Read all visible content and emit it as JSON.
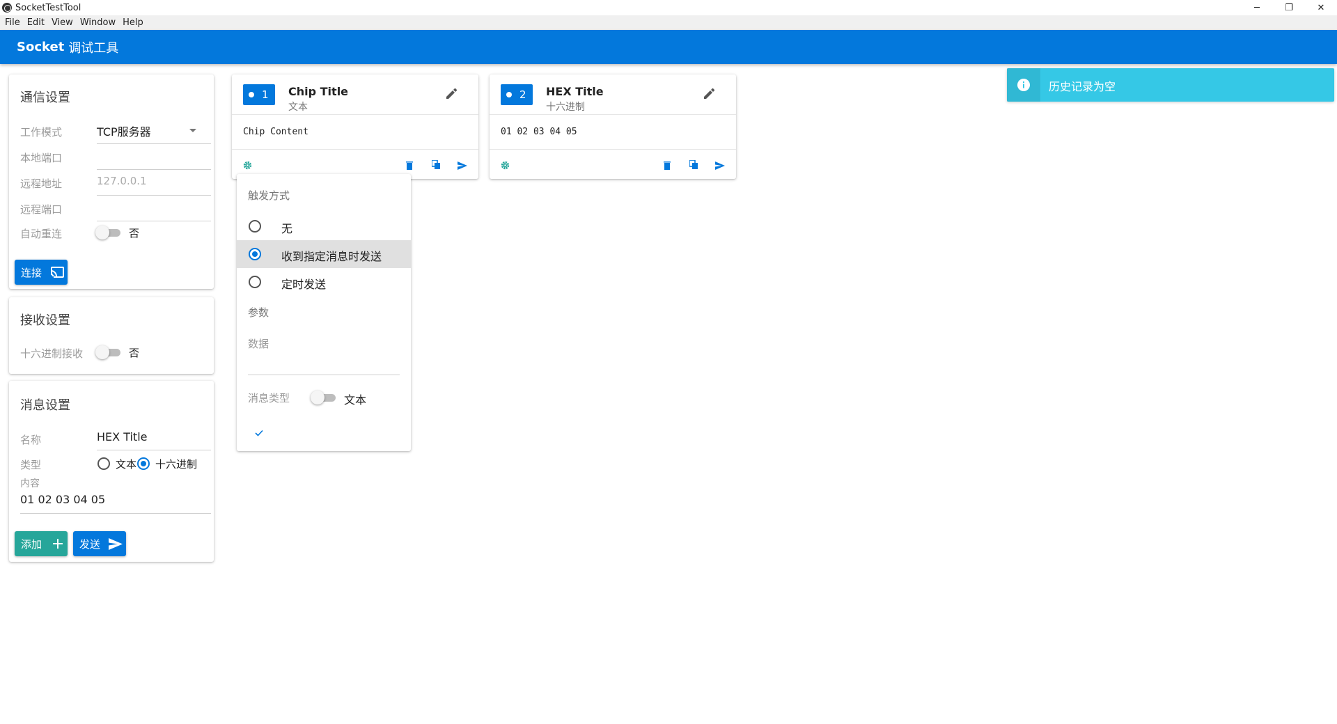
{
  "window": {
    "title": "SocketTestTool",
    "minimize": "─",
    "restore": "❐",
    "close": "✕"
  },
  "menu": [
    "File",
    "Edit",
    "View",
    "Window",
    "Help"
  ],
  "appbar": {
    "title_bold": "Socket",
    "title_rest": "调试工具"
  },
  "comm": {
    "title": "通信设置",
    "mode_label": "工作模式",
    "mode_value": "TCP服务器",
    "local_port_label": "本地端口",
    "local_port_value": "",
    "remote_addr_label": "远程地址",
    "remote_addr_placeholder": "127.0.0.1",
    "remote_port_label": "远程端口",
    "remote_port_value": "",
    "reconnect_label": "自动重连",
    "reconnect_state": "否",
    "connect_button": "连接"
  },
  "receive": {
    "title": "接收设置",
    "hex_label": "十六进制接收",
    "hex_state": "否"
  },
  "message": {
    "title": "消息设置",
    "name_label": "名称",
    "name_value": "HEX Title",
    "type_label": "类型",
    "type_options": [
      "文本",
      "十六进制"
    ],
    "type_selected": "十六进制",
    "content_label": "内容",
    "content_value": "01 02 03 04 05",
    "add_button": "添加",
    "send_button": "发送"
  },
  "chips": [
    {
      "index": "1",
      "title": "Chip Title",
      "subtitle": "文本",
      "content": "Chip Content"
    },
    {
      "index": "2",
      "title": "HEX Title",
      "subtitle": "十六进制",
      "content": "01 02 03 04 05"
    }
  ],
  "trigger_panel": {
    "title": "触发方式",
    "options": [
      "无",
      "收到指定消息时发送",
      "定时发送"
    ],
    "selected": "收到指定消息时发送",
    "params_label": "参数",
    "data_label": "数据",
    "data_value": "",
    "msg_type_label": "消息类型",
    "msg_type_state": "文本",
    "confirm_icon": "check-icon"
  },
  "snackbar": {
    "message": "历史记录为空",
    "icon": "info-icon"
  },
  "colors": {
    "primary": "#0378dc",
    "teal": "#26a69a",
    "snackbar": "#35c8e6"
  }
}
